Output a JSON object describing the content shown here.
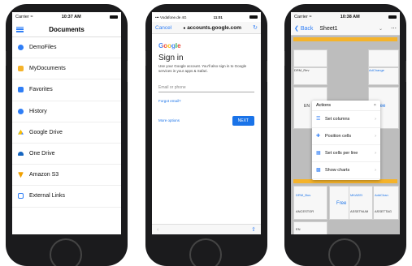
{
  "phone1": {
    "status": {
      "carrier": "Carrier ≈",
      "time": "10:37 AM"
    },
    "title": "Documents",
    "items": [
      {
        "label": "DemoFiles",
        "icon": "cloud-icon",
        "color": "#2f7ef6"
      },
      {
        "label": "MyDocuments",
        "icon": "folder-icon",
        "color": "#f5b32a"
      },
      {
        "label": "Favorites",
        "icon": "favorites-icon",
        "color": "#2f7ef6"
      },
      {
        "label": "History",
        "icon": "history-icon",
        "color": "#2f7ef6"
      },
      {
        "label": "Google Drive",
        "icon": "google-drive-icon",
        "color": "#34a853"
      },
      {
        "label": "One Drive",
        "icon": "onedrive-icon",
        "color": "#1565c0"
      },
      {
        "label": "Amazon S3",
        "icon": "amazon-s3-icon",
        "color": "#f0a000"
      },
      {
        "label": "External Links",
        "icon": "external-link-icon",
        "color": "#2f7ef6"
      }
    ]
  },
  "phone2": {
    "status": {
      "carrier": "••• Vodafone.de 4G",
      "time": "11:01"
    },
    "cancel": "Cancel",
    "url": "accounts.google.com",
    "logo": "Google",
    "heading": "Sign in",
    "description": "Use your Google account. You'll also sign in to Google services in your apps & Safari.",
    "email_placeholder": "Email or phone",
    "forgot": "Forgot email?",
    "more_options": "More options",
    "next": "NEXT"
  },
  "phone3": {
    "status": {
      "carrier": "Carrier ≈",
      "time": "10:38 AM"
    },
    "back": "Back",
    "sheet": "Sheet1",
    "dialog": {
      "title": "Actions",
      "close": "×",
      "options": [
        {
          "label": "Set columns",
          "icon": "columns-icon"
        },
        {
          "label": "Position cells",
          "icon": "position-icon"
        },
        {
          "label": "Set cells per line",
          "icon": "cells-per-line-icon"
        },
        {
          "label": "Show charts",
          "icon": "charts-icon"
        }
      ]
    },
    "cells": {
      "c1": "DRM_Rev",
      "c2": "EN",
      "c3": "AdChange",
      "c4": "Free",
      "c5": "DRM_Bus",
      "c6": "MKAEEI",
      "c7": "AddChan",
      "c8": "ANCESTOR",
      "c9": "Free",
      "c10": "ASSETNUM",
      "c11": "ASSETTAG",
      "c12": "EN"
    }
  }
}
